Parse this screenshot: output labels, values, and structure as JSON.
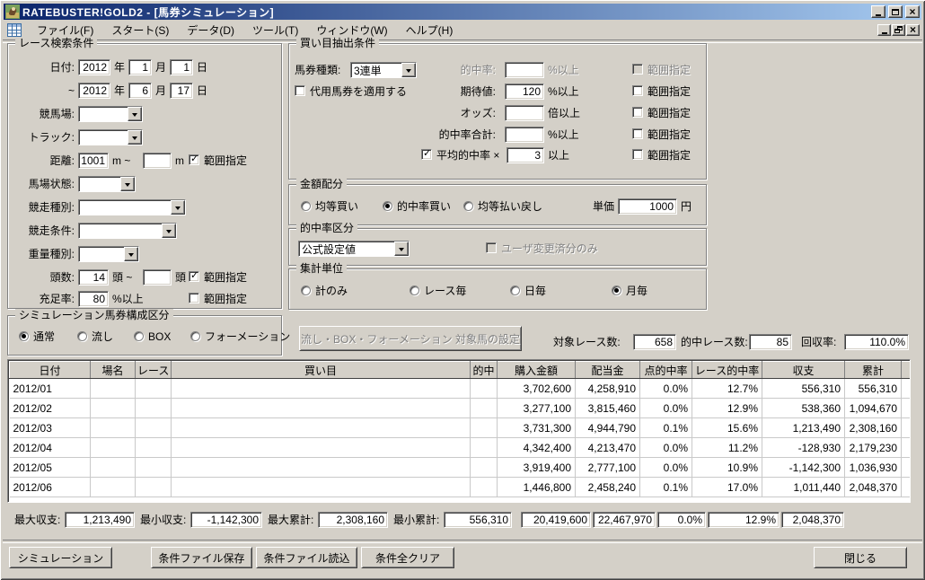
{
  "titlebar": {
    "title": "RATEBUSTER!GOLD2 - [馬券シミュレーション]"
  },
  "menubar": {
    "items": [
      "ファイル(F)",
      "スタート(S)",
      "データ(D)",
      "ツール(T)",
      "ウィンドウ(W)",
      "ヘルプ(H)"
    ]
  },
  "race_search": {
    "legend": "レース検索条件",
    "date_label": "日付:",
    "tilde_label": "~",
    "from_year": "2012",
    "from_month": "1",
    "from_day": "1",
    "to_year": "2012",
    "to_month": "6",
    "to_day": "17",
    "year_unit": "年",
    "month_unit": "月",
    "day_unit": "日",
    "course_label": "競馬場:",
    "course_value": "",
    "track_label": "トラック:",
    "track_value": "",
    "distance_label": "距離:",
    "distance_from": "1001",
    "distance_mid": "m ~",
    "distance_to": "",
    "distance_unit": "m",
    "surface_label": "馬場状態:",
    "surface_value": "",
    "race_type_label": "競走種別:",
    "race_type_value": "",
    "race_cond_label": "競走条件:",
    "race_cond_value": "",
    "weight_label": "重量種別:",
    "weight_value": "",
    "heads_label": "頭数:",
    "heads_from": "14",
    "heads_mid": "頭 ~",
    "heads_to": "",
    "heads_unit": "頭",
    "fill_label": "充足率:",
    "fill_value": "80",
    "fill_unit": "%以上",
    "range_label": "範囲指定",
    "distance_range_checked": true,
    "heads_range_checked": true,
    "fill_range_checked": false
  },
  "bet_extract": {
    "legend": "買い目抽出条件",
    "ticket_label": "馬券種類:",
    "ticket_value": "3連単",
    "substitute_label": "代用馬券を適用する",
    "substitute_checked": false,
    "hit_rate_label": "的中率:",
    "hit_rate_value": "",
    "hit_rate_unit": "%以上",
    "hit_rate_range_checked": false,
    "expect_label": "期待値:",
    "expect_value": "120",
    "expect_unit": "%以上",
    "expect_range_checked": false,
    "odds_label": "オッズ:",
    "odds_value": "",
    "odds_unit": "倍以上",
    "odds_range_checked": false,
    "hit_sum_label": "的中率合計:",
    "hit_sum_value": "",
    "hit_sum_unit": "%以上",
    "hit_sum_range_checked": false,
    "avg_hit_label": "平均的中率 ×",
    "avg_hit_value": "3",
    "avg_hit_unit": "以上",
    "avg_hit_checked": true,
    "avg_hit_range_checked": false,
    "range_label": "範囲指定"
  },
  "amount": {
    "legend": "金額配分",
    "options": [
      "均等買い",
      "的中率買い",
      "均等払い戻し"
    ],
    "selected": "的中率買い",
    "unit_price_label": "単価",
    "unit_price_value": "1000",
    "unit_price_unit": "円"
  },
  "hit_rate_class": {
    "legend": "的中率区分",
    "value": "公式設定値",
    "user_only_label": "ユーザ変更済分のみ",
    "user_only_checked": false
  },
  "aggregate": {
    "legend": "集計単位",
    "options": [
      "計のみ",
      "レース毎",
      "日毎",
      "月毎"
    ],
    "selected": "月毎"
  },
  "sim_type": {
    "legend": "シミュレーション馬券構成区分",
    "options": [
      "通常",
      "流し",
      "BOX",
      "フォーメーション"
    ],
    "selected": "通常"
  },
  "target_button_label": "流し・BOX・フォーメーション 対象馬の設定",
  "stats": {
    "target_races_label": "対象レース数:",
    "target_races": "658",
    "hit_races_label": "的中レース数:",
    "hit_races": "85",
    "recovery_label": "回収率:",
    "recovery": "110.0%"
  },
  "table": {
    "columns": [
      "日付",
      "場名",
      "レース",
      "買い目",
      "的中",
      "購入金額",
      "配当金",
      "点的中率",
      "レース的中率",
      "収支",
      "累計"
    ],
    "rows": [
      [
        "2012/01",
        "",
        "",
        "",
        "",
        "3,702,600",
        "4,258,910",
        "0.0%",
        "12.7%",
        "556,310",
        "556,310"
      ],
      [
        "2012/02",
        "",
        "",
        "",
        "",
        "3,277,100",
        "3,815,460",
        "0.0%",
        "12.9%",
        "538,360",
        "1,094,670"
      ],
      [
        "2012/03",
        "",
        "",
        "",
        "",
        "3,731,300",
        "4,944,790",
        "0.1%",
        "15.6%",
        "1,213,490",
        "2,308,160"
      ],
      [
        "2012/04",
        "",
        "",
        "",
        "",
        "4,342,400",
        "4,213,470",
        "0.0%",
        "11.2%",
        "-128,930",
        "2,179,230"
      ],
      [
        "2012/05",
        "",
        "",
        "",
        "",
        "3,919,400",
        "2,777,100",
        "0.0%",
        "10.9%",
        "-1,142,300",
        "1,036,930"
      ],
      [
        "2012/06",
        "",
        "",
        "",
        "",
        "1,446,800",
        "2,458,240",
        "0.1%",
        "17.0%",
        "1,011,440",
        "2,048,370"
      ]
    ]
  },
  "summary": {
    "max_balance_label": "最大収支:",
    "max_balance": "1,213,490",
    "min_balance_label": "最小収支:",
    "min_balance": "-1,142,300",
    "max_total_label": "最大累計:",
    "max_total": "2,308,160",
    "min_total_label": "最小累計:",
    "min_total": "556,310",
    "total_purchase": "20,419,600",
    "total_payout": "22,467,970",
    "total_point_rate": "0.0%",
    "total_race_rate": "12.9%",
    "total_sum": "2,048,370"
  },
  "actions": {
    "simulate": "シミュレーション",
    "save": "条件ファイル保存",
    "load": "条件ファイル読込",
    "clear": "条件全クリア",
    "close": "閉じる"
  }
}
